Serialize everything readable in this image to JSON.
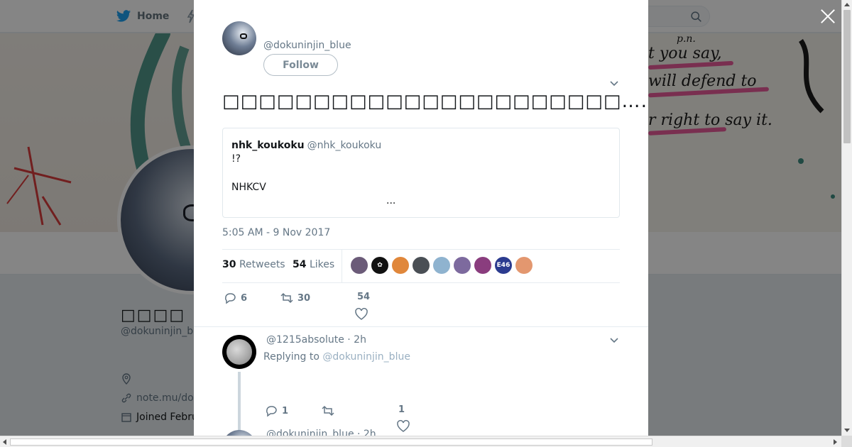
{
  "nav": {
    "home_label": "Home",
    "search_icon": "search-icon"
  },
  "profile": {
    "display_name": "□□□□",
    "handle": "@dokuninjin_b",
    "link": "note.mu/do",
    "joined": "Joined Febru"
  },
  "banner_text": {
    "line1": "t you say,",
    "line2": "will defend to",
    "line3": "r right to say it.",
    "small": "p.n."
  },
  "modal": {
    "author_handle": "@dokuninjin_blue",
    "follow_label": "Follow",
    "tweet_text": "□□□□□□□□□□□□□□□□□□□□□□……□□□□□□□□□□□□□□□□□□□□□□□□□□□□□□□□□□□□",
    "quote": {
      "name": "nhk_koukoku",
      "handle": "@nhk_koukoku",
      "line1": "!?",
      "line2": "NHKCV",
      "more": "..."
    },
    "timestamp": "5:05 AM - 9 Nov 2017",
    "retweets_count": "30",
    "retweets_label": "Retweets",
    "likes_count": "54",
    "likes_label": "Likes",
    "likers": [
      {
        "color": "#6b5b78",
        "label": ""
      },
      {
        "color": "#111111",
        "label": "✿"
      },
      {
        "color": "#e0873b",
        "label": ""
      },
      {
        "color": "#4a4f55",
        "label": ""
      },
      {
        "color": "#8fb3cf",
        "label": ""
      },
      {
        "color": "#7d6a9e",
        "label": ""
      },
      {
        "color": "#8a3d7e",
        "label": ""
      },
      {
        "color": "#2b3b8f",
        "label": "E46"
      },
      {
        "color": "#e3976f",
        "label": ""
      }
    ],
    "actions": {
      "reply_count": "6",
      "retweet_count": "30",
      "like_count": "54"
    }
  },
  "reply": {
    "header": "@1215absolute · 2h",
    "replying_prefix": "Replying to",
    "replying_to": "@dokuninjin_blue",
    "reply_count": "1",
    "like_count": "1"
  },
  "next_reply": {
    "header": "@dokuninjin_blue · 2h"
  },
  "colors": {
    "accent": "#1da1f2",
    "muted": "#657786",
    "overlay": "rgba(0,0,0,0.48)"
  }
}
